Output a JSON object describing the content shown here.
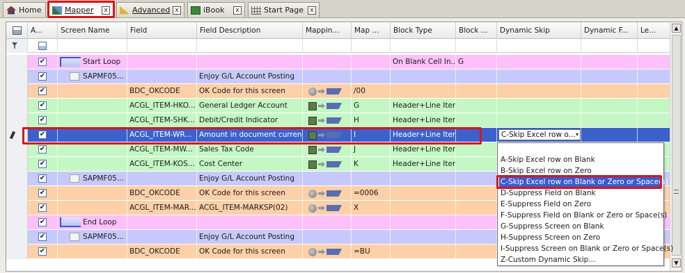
{
  "tabs": [
    {
      "label": "Home",
      "icon": "home-icon"
    },
    {
      "label": "Mapper",
      "icon": "mapper-icon",
      "close": "x"
    },
    {
      "label": "Advanced",
      "icon": "ruler-icon",
      "close": "x"
    },
    {
      "label": "iBook",
      "icon": "book-icon",
      "close": "x"
    },
    {
      "label": "Start Page",
      "icon": "grid-icon",
      "close": "x"
    }
  ],
  "columns": {
    "active": "A...",
    "screen_name": "Screen Name",
    "field": "Field",
    "field_desc": "Field Description",
    "mapping": "Mappin...",
    "map": "Map ...",
    "block_type": "Block Type",
    "block": "Block ...",
    "dynamic_skip": "Dynamic Skip",
    "dynamic_f": "Dynamic F...",
    "le": "Le..."
  },
  "rows": [
    {
      "screen": "Start Loop",
      "field": "",
      "desc": "",
      "map": "",
      "block_type": "On Blank Cell In...",
      "block": "G",
      "color": "#fdc0fb",
      "kind": "loopstart"
    },
    {
      "screen": "SAPMF05...",
      "field": "",
      "desc": "Enjoy G/L Account Posting",
      "map": "",
      "block_type": "",
      "block": "",
      "color": "#c8c9fb",
      "kind": "screen"
    },
    {
      "screen": "",
      "field": "BDC_OKCODE",
      "desc": "OK Code for this screen",
      "map": "/00",
      "block_type": "",
      "block": "",
      "color": "#fdd0a8",
      "kind": "okcode"
    },
    {
      "screen": "",
      "field": "ACGL_ITEM-HKO...",
      "desc": "General Ledger Account",
      "map": "G",
      "block_type": "Header+Line Item",
      "block": "",
      "color": "#c5f7c5",
      "kind": "field"
    },
    {
      "screen": "",
      "field": "ACGL_ITEM-SHK...",
      "desc": "Debit/Credit Indicator",
      "map": "H",
      "block_type": "Header+Line Item",
      "block": "",
      "color": "#c5f7c5",
      "kind": "field"
    },
    {
      "screen": "",
      "field": "ACGL_ITEM-WR...",
      "desc": "Amount in document currency",
      "map": "I",
      "block_type": "Header+Line Item",
      "block": "",
      "color": "#3c61cb",
      "kind": "selected",
      "skip": "C-Skip Excel row o..."
    },
    {
      "screen": "",
      "field": "ACGL_ITEM-MW...",
      "desc": "Sales Tax Code",
      "map": "J",
      "block_type": "Header+Line Item",
      "block": "",
      "color": "#c5f7c5",
      "kind": "field"
    },
    {
      "screen": "",
      "field": "ACGL_ITEM-KOS...",
      "desc": "Cost Center",
      "map": "K",
      "block_type": "Header+Line Item",
      "block": "",
      "color": "#c5f7c5",
      "kind": "field"
    },
    {
      "screen": "SAPMF05...",
      "field": "",
      "desc": "Enjoy G/L Account Posting",
      "map": "",
      "block_type": "",
      "block": "",
      "color": "#c8c9fb",
      "kind": "screen"
    },
    {
      "screen": "",
      "field": "BDC_OKCODE",
      "desc": "OK Code for this screen",
      "map": "=0006",
      "block_type": "",
      "block": "",
      "color": "#fdd0a8",
      "kind": "okcode"
    },
    {
      "screen": "",
      "field": "ACGL_ITEM-MAR...",
      "desc": "ACGL_ITEM-MARKSP(02)",
      "map": "X",
      "block_type": "",
      "block": "",
      "color": "#fdd0a8",
      "kind": "okcode"
    },
    {
      "screen": "End Loop",
      "field": "",
      "desc": "",
      "map": "",
      "block_type": "",
      "block": "",
      "color": "#fdc0fb",
      "kind": "loopend"
    },
    {
      "screen": "SAPMF05...",
      "field": "",
      "desc": "Enjoy G/L Account Posting",
      "map": "",
      "block_type": "",
      "block": "",
      "color": "#c8c9fb",
      "kind": "screen"
    },
    {
      "screen": "",
      "field": "BDC_OKCODE",
      "desc": "OK Code for this screen",
      "map": "=BU",
      "block_type": "",
      "block": "",
      "color": "#fdd0a8",
      "kind": "okcode"
    }
  ],
  "dropdown": {
    "options": [
      "A-Skip Excel row on Blank",
      "B-Skip Excel row on Zero",
      "C-Skip Excel row on Blank or Zero or Space(s)",
      "D-Suppress Field on Blank",
      "E-Suppress Field on Zero",
      "F-Suppress Field on Blank or Zero or Space(s)",
      "G-Suppress Screen on Blank",
      "H-Suppress Screen on Zero",
      "I-Suppress Screen on Blank or Zero or Space(s)",
      "Z-Custom Dynamic Skip..."
    ],
    "selected_index": 2
  },
  "colors": {
    "loop": "#fdc0fb",
    "screen": "#c8c9fb",
    "okcode": "#fdd0a8",
    "field": "#c5f7c5",
    "selected": "#3c61cb",
    "highlight": "#d6171c"
  }
}
